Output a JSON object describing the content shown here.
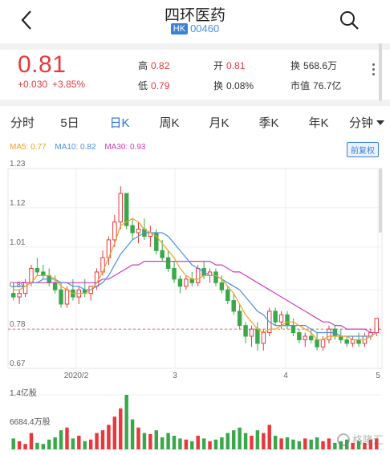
{
  "header": {
    "title": "四环医药",
    "market_badge": "HK",
    "code": "00460"
  },
  "quote": {
    "price": "0.81",
    "change": "+0.030",
    "change_pct": "+3.85%",
    "high_label": "高",
    "high_value": "0.82",
    "low_label": "低",
    "low_value": "0.79",
    "open_label": "开",
    "open_value": "0.81",
    "turnover_rate_label": "换",
    "turnover_rate_value": "0.08%",
    "turnover_label": "换",
    "turnover_value": "568.6万",
    "mktcap_label": "市值",
    "mktcap_value": "76.7亿"
  },
  "tabs": [
    {
      "label": "分时"
    },
    {
      "label": "5日"
    },
    {
      "label": "日K"
    },
    {
      "label": "周K"
    },
    {
      "label": "月K"
    },
    {
      "label": "季K"
    },
    {
      "label": "年K"
    },
    {
      "label": "分钟"
    }
  ],
  "active_tab": "日K",
  "ma": {
    "ma5": "MA5: 0.77",
    "ma10": "MA10: 0.82",
    "ma30": "MA30: 0.93",
    "restore": "前复权"
  },
  "colors": {
    "up": "#e8383d",
    "down": "#3aa84a",
    "ma5": "#f0a020",
    "ma10": "#4a90e2",
    "ma30": "#d03cc0",
    "accent": "#2b6cd6"
  },
  "volume": {
    "max_label": "1.4亿股",
    "mid_label": "6684.4万股"
  },
  "watermark": "格隆汇",
  "chart_data": {
    "type": "candlestick",
    "y_ticks": [
      "1.23",
      "1.12",
      "1.01",
      "0.89",
      "0.78",
      "0.67"
    ],
    "ylim": [
      0.67,
      1.23
    ],
    "x_ticks": [
      "2020/2",
      "3",
      "4",
      "5"
    ],
    "reference_price": 0.78,
    "ohlc": [
      [
        0.88,
        0.9,
        0.86,
        0.87
      ],
      [
        0.87,
        0.89,
        0.85,
        0.88
      ],
      [
        0.88,
        0.92,
        0.87,
        0.91
      ],
      [
        0.91,
        0.96,
        0.9,
        0.95
      ],
      [
        0.95,
        0.98,
        0.93,
        0.94
      ],
      [
        0.94,
        0.96,
        0.92,
        0.93
      ],
      [
        0.93,
        0.95,
        0.9,
        0.91
      ],
      [
        0.91,
        0.93,
        0.88,
        0.89
      ],
      [
        0.89,
        0.91,
        0.84,
        0.85
      ],
      [
        0.85,
        0.9,
        0.84,
        0.89
      ],
      [
        0.89,
        0.92,
        0.86,
        0.87
      ],
      [
        0.87,
        0.9,
        0.85,
        0.89
      ],
      [
        0.89,
        0.92,
        0.87,
        0.88
      ],
      [
        0.88,
        0.9,
        0.86,
        0.9
      ],
      [
        0.9,
        0.95,
        0.89,
        0.94
      ],
      [
        0.94,
        1.0,
        0.93,
        0.98
      ],
      [
        0.98,
        1.04,
        0.96,
        1.03
      ],
      [
        1.03,
        1.1,
        1.01,
        1.08
      ],
      [
        1.08,
        1.18,
        1.06,
        1.16
      ],
      [
        1.16,
        1.14,
        1.06,
        1.07
      ],
      [
        1.07,
        1.09,
        1.03,
        1.05
      ],
      [
        1.05,
        1.08,
        1.02,
        1.06
      ],
      [
        1.06,
        1.09,
        1.03,
        1.04
      ],
      [
        1.04,
        1.07,
        1.01,
        1.05
      ],
      [
        1.05,
        1.06,
        0.99,
        1.0
      ],
      [
        1.0,
        1.03,
        0.97,
        0.98
      ],
      [
        0.98,
        1.0,
        0.94,
        0.95
      ],
      [
        0.95,
        0.97,
        0.91,
        0.92
      ],
      [
        0.92,
        0.93,
        0.88,
        0.9
      ],
      [
        0.9,
        0.93,
        0.89,
        0.92
      ],
      [
        0.92,
        0.94,
        0.9,
        0.91
      ],
      [
        0.91,
        0.96,
        0.9,
        0.95
      ],
      [
        0.95,
        0.97,
        0.92,
        0.93
      ],
      [
        0.93,
        0.95,
        0.91,
        0.94
      ],
      [
        0.94,
        0.95,
        0.9,
        0.91
      ],
      [
        0.91,
        0.93,
        0.88,
        0.89
      ],
      [
        0.89,
        0.9,
        0.85,
        0.86
      ],
      [
        0.86,
        0.88,
        0.82,
        0.83
      ],
      [
        0.83,
        0.85,
        0.78,
        0.79
      ],
      [
        0.79,
        0.8,
        0.74,
        0.76
      ],
      [
        0.76,
        0.79,
        0.73,
        0.78
      ],
      [
        0.78,
        0.8,
        0.72,
        0.74
      ],
      [
        0.74,
        0.78,
        0.72,
        0.77
      ],
      [
        0.77,
        0.84,
        0.76,
        0.83
      ],
      [
        0.83,
        0.84,
        0.79,
        0.8
      ],
      [
        0.8,
        0.83,
        0.78,
        0.82
      ],
      [
        0.82,
        0.83,
        0.78,
        0.79
      ],
      [
        0.79,
        0.81,
        0.76,
        0.77
      ],
      [
        0.77,
        0.78,
        0.74,
        0.75
      ],
      [
        0.75,
        0.77,
        0.73,
        0.76
      ],
      [
        0.76,
        0.78,
        0.74,
        0.75
      ],
      [
        0.75,
        0.77,
        0.72,
        0.73
      ],
      [
        0.73,
        0.76,
        0.72,
        0.75
      ],
      [
        0.75,
        0.79,
        0.74,
        0.78
      ],
      [
        0.78,
        0.79,
        0.75,
        0.76
      ],
      [
        0.76,
        0.78,
        0.74,
        0.75
      ],
      [
        0.75,
        0.76,
        0.73,
        0.74
      ],
      [
        0.74,
        0.76,
        0.73,
        0.75
      ],
      [
        0.75,
        0.77,
        0.73,
        0.74
      ],
      [
        0.74,
        0.77,
        0.73,
        0.76
      ],
      [
        0.76,
        0.78,
        0.75,
        0.77
      ],
      [
        0.77,
        0.81,
        0.76,
        0.81
      ]
    ],
    "ma5": [
      0.89,
      0.89,
      0.9,
      0.91,
      0.93,
      0.93,
      0.93,
      0.92,
      0.9,
      0.89,
      0.88,
      0.88,
      0.88,
      0.89,
      0.91,
      0.94,
      0.98,
      1.02,
      1.07,
      1.08,
      1.09,
      1.08,
      1.06,
      1.05,
      1.04,
      1.02,
      1.0,
      0.98,
      0.95,
      0.93,
      0.92,
      0.92,
      0.93,
      0.93,
      0.93,
      0.92,
      0.9,
      0.88,
      0.85,
      0.82,
      0.8,
      0.78,
      0.77,
      0.78,
      0.78,
      0.79,
      0.8,
      0.8,
      0.79,
      0.78,
      0.77,
      0.75,
      0.75,
      0.76,
      0.76,
      0.76,
      0.76,
      0.75,
      0.75,
      0.75,
      0.76,
      0.77
    ],
    "ma10": [
      0.9,
      0.9,
      0.9,
      0.91,
      0.91,
      0.92,
      0.92,
      0.92,
      0.91,
      0.91,
      0.9,
      0.9,
      0.89,
      0.89,
      0.9,
      0.91,
      0.93,
      0.96,
      0.99,
      1.01,
      1.03,
      1.04,
      1.05,
      1.05,
      1.05,
      1.05,
      1.04,
      1.02,
      1.0,
      0.98,
      0.96,
      0.95,
      0.94,
      0.93,
      0.93,
      0.92,
      0.91,
      0.9,
      0.89,
      0.87,
      0.85,
      0.83,
      0.82,
      0.8,
      0.79,
      0.79,
      0.79,
      0.79,
      0.79,
      0.79,
      0.78,
      0.77,
      0.77,
      0.77,
      0.77,
      0.76,
      0.76,
      0.76,
      0.76,
      0.76,
      0.76,
      0.77
    ],
    "ma30": [
      0.91,
      0.91,
      0.91,
      0.91,
      0.91,
      0.91,
      0.91,
      0.91,
      0.91,
      0.91,
      0.91,
      0.91,
      0.91,
      0.91,
      0.91,
      0.92,
      0.92,
      0.93,
      0.94,
      0.95,
      0.96,
      0.96,
      0.97,
      0.97,
      0.97,
      0.97,
      0.97,
      0.97,
      0.97,
      0.97,
      0.97,
      0.97,
      0.97,
      0.97,
      0.96,
      0.96,
      0.95,
      0.94,
      0.94,
      0.93,
      0.92,
      0.91,
      0.9,
      0.89,
      0.88,
      0.87,
      0.86,
      0.85,
      0.84,
      0.83,
      0.82,
      0.81,
      0.8,
      0.8,
      0.79,
      0.79,
      0.78,
      0.78,
      0.78,
      0.78,
      0.77,
      0.77
    ],
    "volume": [
      0.2,
      0.15,
      0.1,
      0.3,
      0.12,
      0.1,
      0.18,
      0.22,
      0.35,
      0.4,
      0.2,
      0.25,
      0.15,
      0.18,
      0.3,
      0.35,
      0.45,
      0.6,
      0.75,
      1.0,
      0.55,
      0.4,
      0.3,
      0.28,
      0.35,
      0.22,
      0.3,
      0.25,
      0.2,
      0.18,
      0.15,
      0.25,
      0.2,
      0.15,
      0.18,
      0.22,
      0.3,
      0.35,
      0.4,
      0.3,
      0.25,
      0.35,
      0.3,
      0.45,
      0.25,
      0.2,
      0.22,
      0.18,
      0.15,
      0.2,
      0.18,
      0.22,
      0.15,
      0.2,
      0.12,
      0.15,
      0.18,
      0.12,
      0.15,
      0.12,
      0.18,
      0.2
    ]
  }
}
